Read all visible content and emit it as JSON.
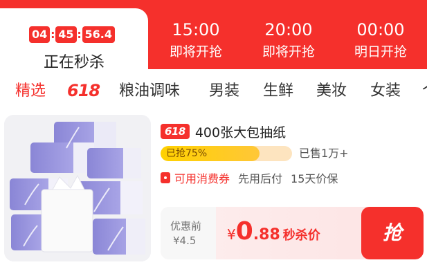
{
  "colors": {
    "accent": "#f5302c",
    "progress_bg": "#fde4bf",
    "progress_fill": "#ffd100"
  },
  "time_bar": {
    "active": {
      "countdown": {
        "hours": "04",
        "minutes": "45",
        "seconds": "56.4"
      },
      "label": "正在秒杀"
    },
    "slots": [
      {
        "time": "15:00",
        "label": "即将开抢"
      },
      {
        "time": "20:00",
        "label": "即将开抢"
      },
      {
        "time": "00:00",
        "label": "明日开抢"
      }
    ]
  },
  "tabs": [
    {
      "label": "精选",
      "selected": true
    },
    {
      "label": "618"
    },
    {
      "label": "粮油调味"
    },
    {
      "label": "男装"
    },
    {
      "label": "生鲜"
    },
    {
      "label": "美妆"
    },
    {
      "label": "女装"
    },
    {
      "label": "个"
    }
  ],
  "product": {
    "image_icon": "tissue-pack-image",
    "badge": "618",
    "title": "400张大包抽纸",
    "progress_label": "已抢75%",
    "progress_fraction": 0.75,
    "sold": "已售1万+",
    "coupon_icon": "coupon-icon",
    "features": [
      "可用消费券",
      "先用后付",
      "15天价保"
    ],
    "original_label": "优惠前",
    "original_price": "¥4.5",
    "price_currency": "¥",
    "price_int": "0",
    "price_dec": ".88",
    "price_tag": "秒杀价",
    "grab_label": "抢"
  }
}
